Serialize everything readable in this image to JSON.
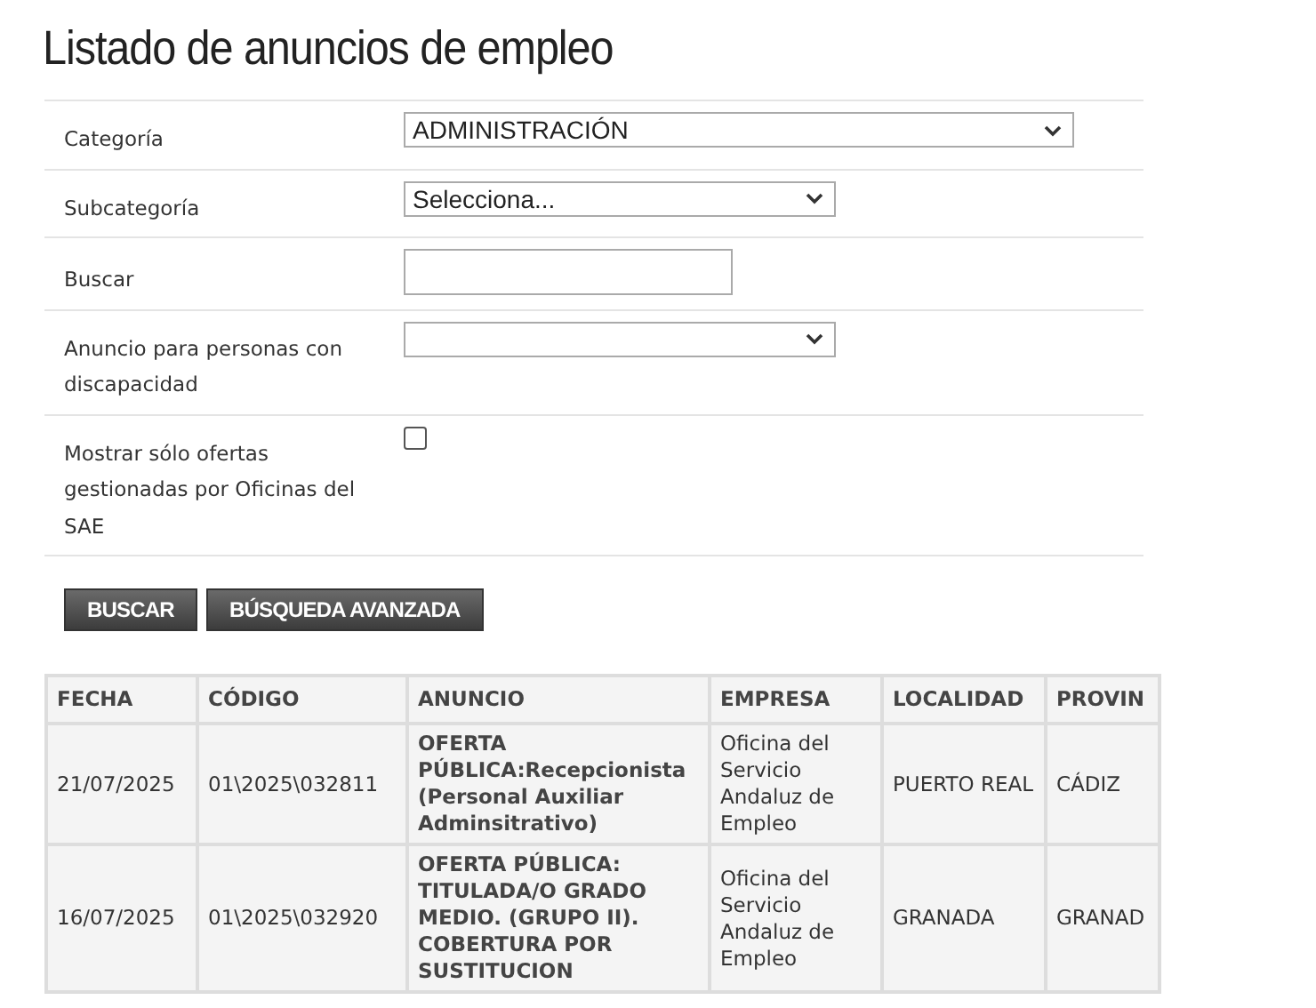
{
  "title": "Listado de anuncios de empleo",
  "form": {
    "fields": [
      {
        "kind": "select",
        "label": "Categoría",
        "value": "ADMINISTRACIÓN"
      },
      {
        "kind": "select",
        "label": "Subcategoría",
        "value": "Selecciona..."
      },
      {
        "kind": "text",
        "label": "Buscar"
      },
      {
        "kind": "select",
        "label": "Anuncio para personas con discapacidad"
      },
      {
        "kind": "checkbox",
        "label": "Mostrar sólo ofertas gestionadas por Oficinas del SAE",
        "checked": false
      }
    ]
  },
  "buttons": [
    "BUSCAR",
    "BÚSQUEDA AVANZADA"
  ],
  "table": {
    "columns": [
      "FECHA",
      "CÓDIGO",
      "ANUNCIO",
      "EMPRESA",
      "LOCALIDAD",
      "PROVIN"
    ],
    "rows": [
      [
        "21/07/2025",
        "01\\2025\\032811",
        "OFERTA PÚBLICA:Recepcionista (Personal Auxiliar Adminsitrativo)",
        "Oficina del Servicio Andaluz de Empleo",
        "PUERTO REAL",
        "CÁDIZ"
      ],
      [
        "16/07/2025",
        "01\\2025\\032920",
        "OFERTA PÚBLICA: TITULADA/O GRADO MEDIO. (GRUPO II). COBERTURA POR SUSTITUCION",
        "Oficina del Servicio Andaluz de Empleo",
        "GRANADA",
        "GRANAD"
      ]
    ]
  }
}
